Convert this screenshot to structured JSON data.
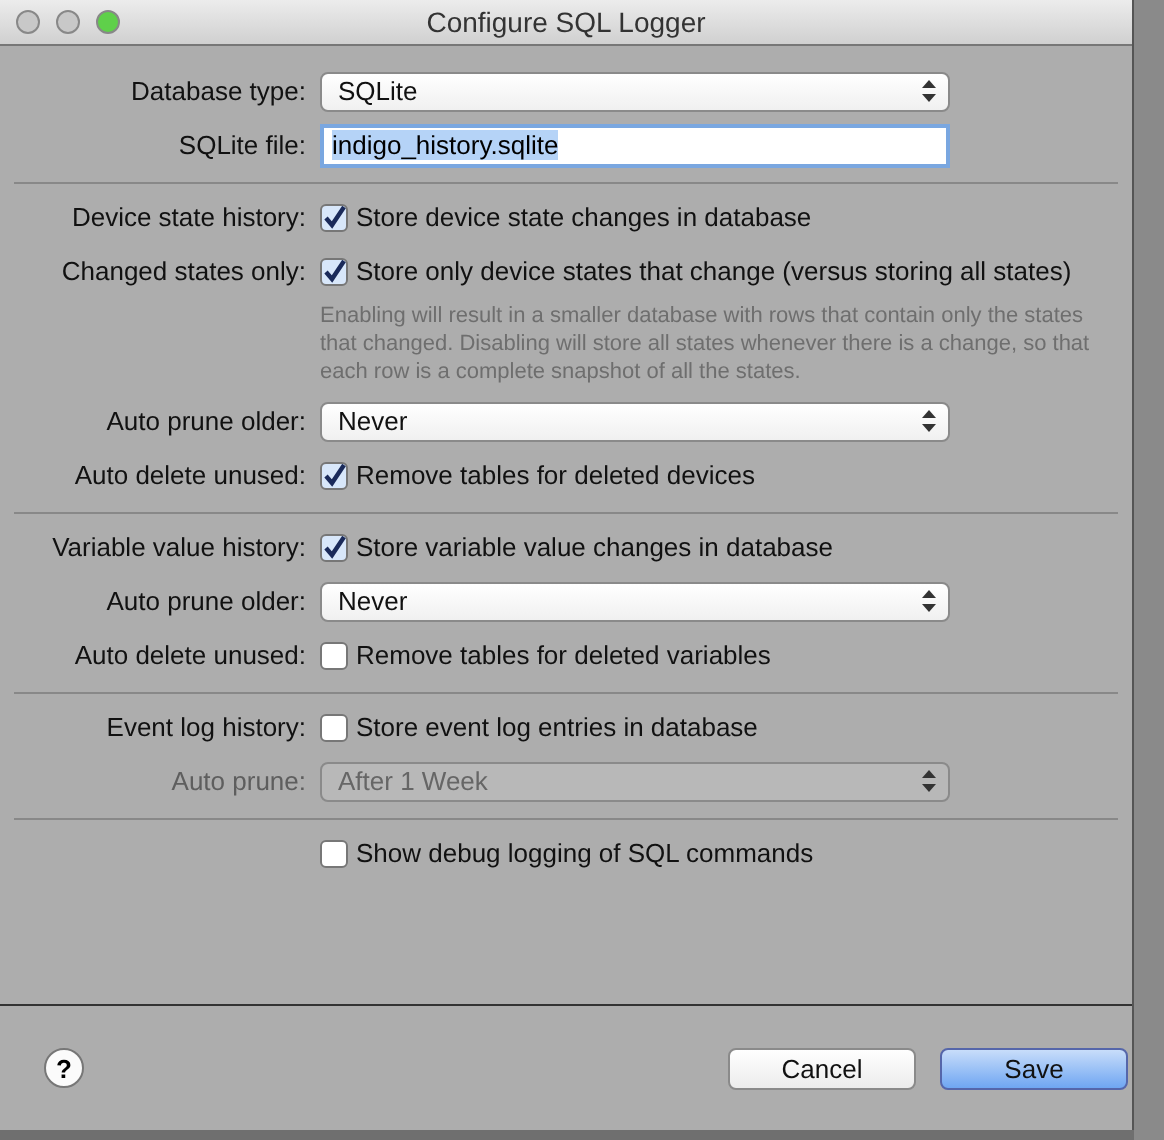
{
  "window": {
    "title": "Configure SQL Logger"
  },
  "sections": [
    {
      "rows": [
        {
          "kind": "select",
          "label": "Database type:",
          "value": "SQLite",
          "disabled": false
        },
        {
          "kind": "text",
          "label": "SQLite file:",
          "value": "indigo_history.sqlite"
        }
      ]
    },
    {
      "rows": [
        {
          "kind": "checkbox",
          "label": "Device state history:",
          "text": "Store device state changes in database",
          "checked": true
        },
        {
          "kind": "checkbox",
          "label": "Changed states only:",
          "text": "Store only device states that change (versus storing all states)",
          "checked": true
        },
        {
          "kind": "note",
          "text": "Enabling will result in a smaller database with rows that contain only the states that changed. Disabling will store all states whenever there is a change, so that each row is a complete snapshot of all the states."
        },
        {
          "kind": "select",
          "label": "Auto prune older:",
          "value": "Never",
          "disabled": false
        },
        {
          "kind": "checkbox",
          "label": "Auto delete unused:",
          "text": "Remove tables for deleted devices",
          "checked": true
        }
      ]
    },
    {
      "rows": [
        {
          "kind": "checkbox",
          "label": "Variable value history:",
          "text": "Store variable value changes in database",
          "checked": true
        },
        {
          "kind": "select",
          "label": "Auto prune older:",
          "value": "Never",
          "disabled": false
        },
        {
          "kind": "checkbox",
          "label": "Auto delete unused:",
          "text": "Remove tables for deleted variables",
          "checked": false
        }
      ]
    },
    {
      "rows": [
        {
          "kind": "checkbox",
          "label": "Event log history:",
          "text": "Store event log entries in database",
          "checked": false
        },
        {
          "kind": "select",
          "label": "Auto prune:",
          "value": "After 1 Week",
          "disabled": true
        }
      ]
    },
    {
      "rows": [
        {
          "kind": "checkbox",
          "text": "Show debug logging of SQL commands",
          "checked": false
        }
      ]
    }
  ],
  "footer": {
    "help": "?",
    "buttons": [
      {
        "label": "Cancel",
        "kind": "normal"
      },
      {
        "label": "Save",
        "kind": "default"
      }
    ]
  }
}
